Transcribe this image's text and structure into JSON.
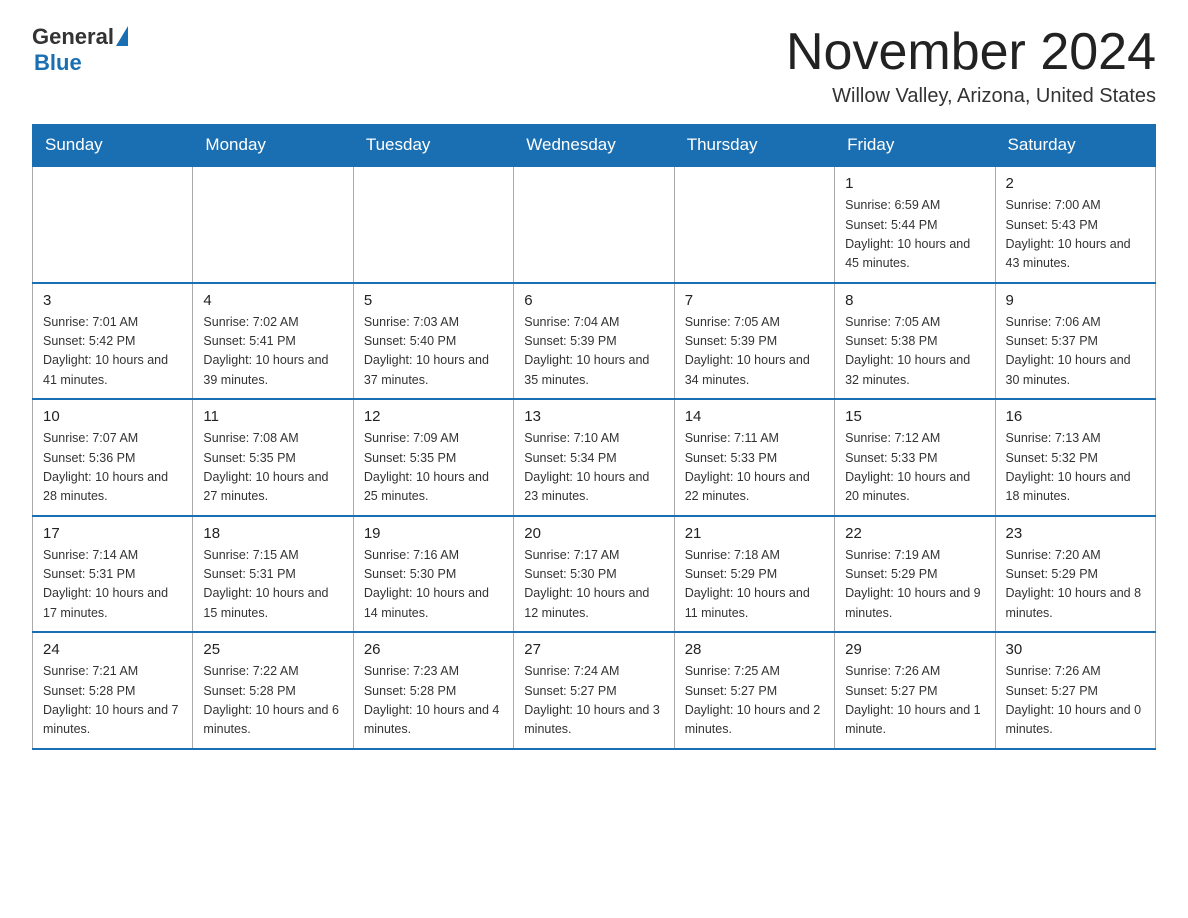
{
  "header": {
    "logo_general": "General",
    "logo_blue": "Blue",
    "month_title": "November 2024",
    "location": "Willow Valley, Arizona, United States"
  },
  "weekdays": [
    "Sunday",
    "Monday",
    "Tuesday",
    "Wednesday",
    "Thursday",
    "Friday",
    "Saturday"
  ],
  "weeks": [
    [
      {
        "day": "",
        "info": ""
      },
      {
        "day": "",
        "info": ""
      },
      {
        "day": "",
        "info": ""
      },
      {
        "day": "",
        "info": ""
      },
      {
        "day": "",
        "info": ""
      },
      {
        "day": "1",
        "info": "Sunrise: 6:59 AM\nSunset: 5:44 PM\nDaylight: 10 hours and 45 minutes."
      },
      {
        "day": "2",
        "info": "Sunrise: 7:00 AM\nSunset: 5:43 PM\nDaylight: 10 hours and 43 minutes."
      }
    ],
    [
      {
        "day": "3",
        "info": "Sunrise: 7:01 AM\nSunset: 5:42 PM\nDaylight: 10 hours and 41 minutes."
      },
      {
        "day": "4",
        "info": "Sunrise: 7:02 AM\nSunset: 5:41 PM\nDaylight: 10 hours and 39 minutes."
      },
      {
        "day": "5",
        "info": "Sunrise: 7:03 AM\nSunset: 5:40 PM\nDaylight: 10 hours and 37 minutes."
      },
      {
        "day": "6",
        "info": "Sunrise: 7:04 AM\nSunset: 5:39 PM\nDaylight: 10 hours and 35 minutes."
      },
      {
        "day": "7",
        "info": "Sunrise: 7:05 AM\nSunset: 5:39 PM\nDaylight: 10 hours and 34 minutes."
      },
      {
        "day": "8",
        "info": "Sunrise: 7:05 AM\nSunset: 5:38 PM\nDaylight: 10 hours and 32 minutes."
      },
      {
        "day": "9",
        "info": "Sunrise: 7:06 AM\nSunset: 5:37 PM\nDaylight: 10 hours and 30 minutes."
      }
    ],
    [
      {
        "day": "10",
        "info": "Sunrise: 7:07 AM\nSunset: 5:36 PM\nDaylight: 10 hours and 28 minutes."
      },
      {
        "day": "11",
        "info": "Sunrise: 7:08 AM\nSunset: 5:35 PM\nDaylight: 10 hours and 27 minutes."
      },
      {
        "day": "12",
        "info": "Sunrise: 7:09 AM\nSunset: 5:35 PM\nDaylight: 10 hours and 25 minutes."
      },
      {
        "day": "13",
        "info": "Sunrise: 7:10 AM\nSunset: 5:34 PM\nDaylight: 10 hours and 23 minutes."
      },
      {
        "day": "14",
        "info": "Sunrise: 7:11 AM\nSunset: 5:33 PM\nDaylight: 10 hours and 22 minutes."
      },
      {
        "day": "15",
        "info": "Sunrise: 7:12 AM\nSunset: 5:33 PM\nDaylight: 10 hours and 20 minutes."
      },
      {
        "day": "16",
        "info": "Sunrise: 7:13 AM\nSunset: 5:32 PM\nDaylight: 10 hours and 18 minutes."
      }
    ],
    [
      {
        "day": "17",
        "info": "Sunrise: 7:14 AM\nSunset: 5:31 PM\nDaylight: 10 hours and 17 minutes."
      },
      {
        "day": "18",
        "info": "Sunrise: 7:15 AM\nSunset: 5:31 PM\nDaylight: 10 hours and 15 minutes."
      },
      {
        "day": "19",
        "info": "Sunrise: 7:16 AM\nSunset: 5:30 PM\nDaylight: 10 hours and 14 minutes."
      },
      {
        "day": "20",
        "info": "Sunrise: 7:17 AM\nSunset: 5:30 PM\nDaylight: 10 hours and 12 minutes."
      },
      {
        "day": "21",
        "info": "Sunrise: 7:18 AM\nSunset: 5:29 PM\nDaylight: 10 hours and 11 minutes."
      },
      {
        "day": "22",
        "info": "Sunrise: 7:19 AM\nSunset: 5:29 PM\nDaylight: 10 hours and 9 minutes."
      },
      {
        "day": "23",
        "info": "Sunrise: 7:20 AM\nSunset: 5:29 PM\nDaylight: 10 hours and 8 minutes."
      }
    ],
    [
      {
        "day": "24",
        "info": "Sunrise: 7:21 AM\nSunset: 5:28 PM\nDaylight: 10 hours and 7 minutes."
      },
      {
        "day": "25",
        "info": "Sunrise: 7:22 AM\nSunset: 5:28 PM\nDaylight: 10 hours and 6 minutes."
      },
      {
        "day": "26",
        "info": "Sunrise: 7:23 AM\nSunset: 5:28 PM\nDaylight: 10 hours and 4 minutes."
      },
      {
        "day": "27",
        "info": "Sunrise: 7:24 AM\nSunset: 5:27 PM\nDaylight: 10 hours and 3 minutes."
      },
      {
        "day": "28",
        "info": "Sunrise: 7:25 AM\nSunset: 5:27 PM\nDaylight: 10 hours and 2 minutes."
      },
      {
        "day": "29",
        "info": "Sunrise: 7:26 AM\nSunset: 5:27 PM\nDaylight: 10 hours and 1 minute."
      },
      {
        "day": "30",
        "info": "Sunrise: 7:26 AM\nSunset: 5:27 PM\nDaylight: 10 hours and 0 minutes."
      }
    ]
  ]
}
